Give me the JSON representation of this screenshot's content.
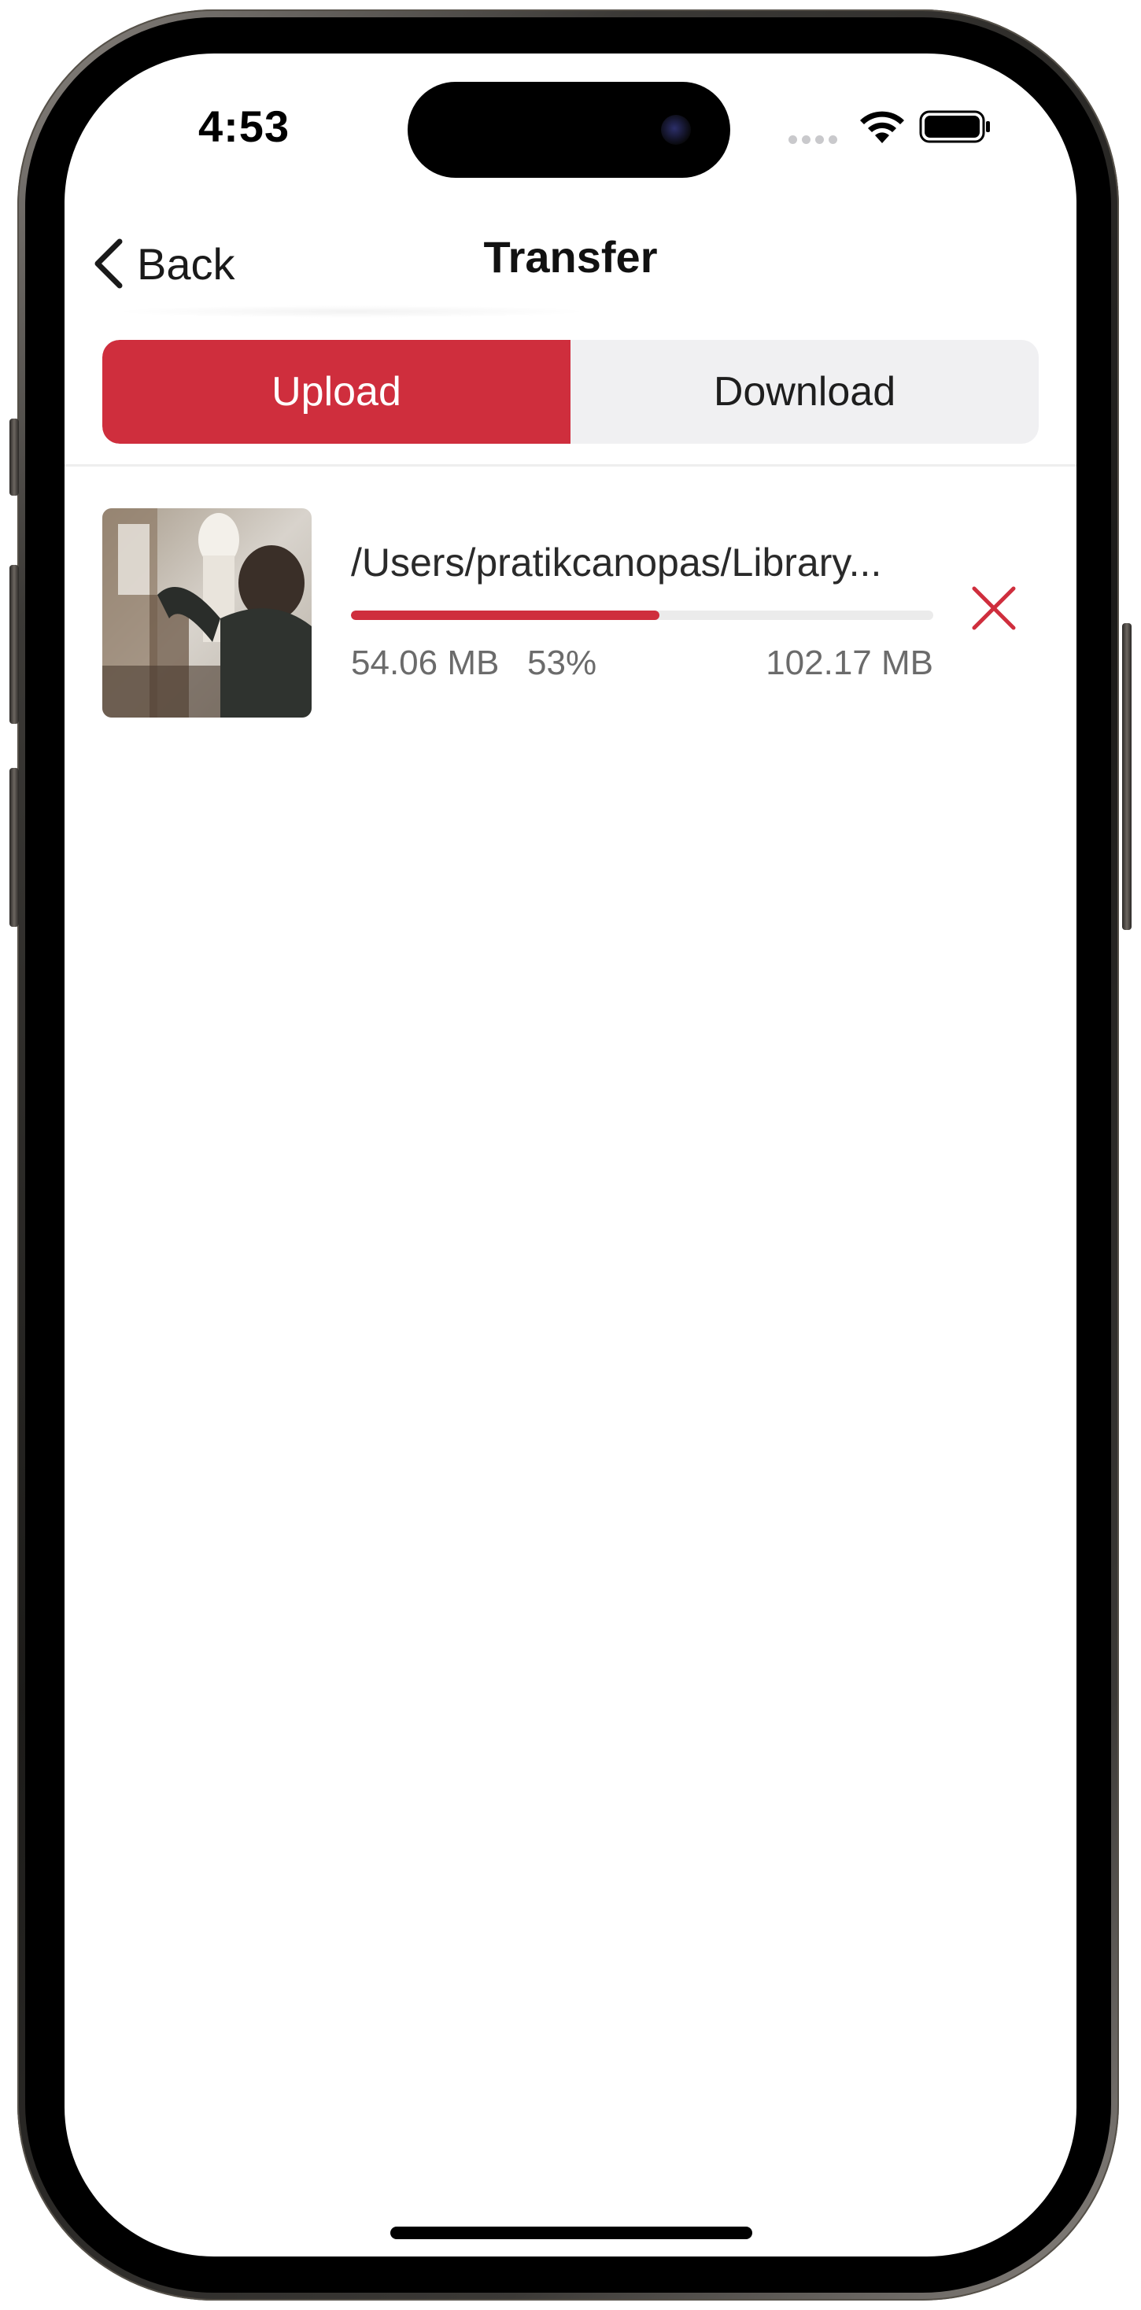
{
  "status_bar": {
    "time": "4:53",
    "icons": [
      "signal-dots-icon",
      "wifi-icon",
      "battery-icon"
    ]
  },
  "nav": {
    "back_label": "Back",
    "title": "Transfer"
  },
  "tabs": [
    {
      "label": "Upload",
      "selected": true
    },
    {
      "label": "Download",
      "selected": false
    }
  ],
  "transfers": [
    {
      "file_name": "/Users/pratikcanopas/Library...",
      "transferred": "54.06 MB",
      "percent_label": "53%",
      "progress": 0.53,
      "total": "102.17 MB",
      "thumbnail": "photo-thumbnail",
      "cancel_icon": "close-icon"
    }
  ],
  "colors": {
    "accent": "#cf2e3d",
    "segment_background": "#f0f0f2",
    "track": "#ebebeb",
    "secondary_text": "#6b6b6b"
  }
}
